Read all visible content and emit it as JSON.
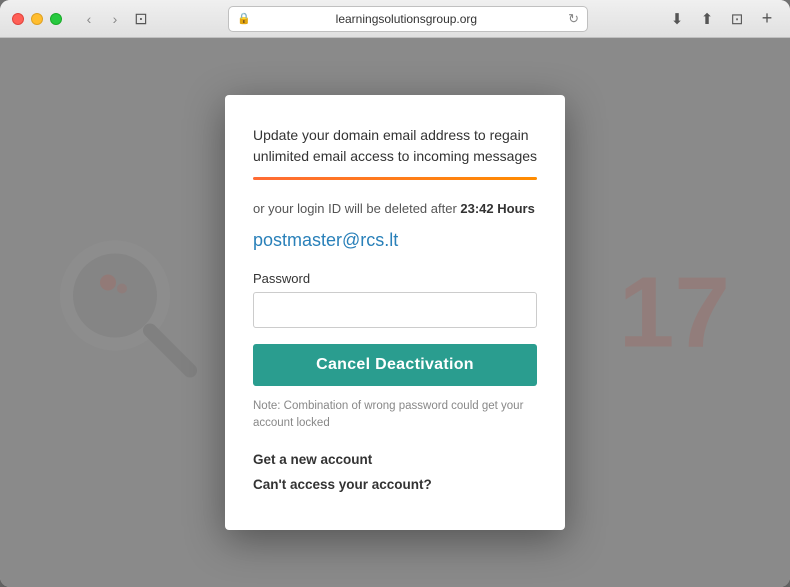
{
  "browser": {
    "url": "learningsolutionsgroup.org",
    "back_disabled": false,
    "forward_disabled": false
  },
  "modal": {
    "header_line1": "Update your domain email address to regain",
    "header_line2": "unlimited email access to incoming messages",
    "warning_prefix": "or your login ID will be deleted after ",
    "timer": "23:42 Hours",
    "email": "postmaster@rcs.lt",
    "password_label": "Password",
    "password_placeholder": "",
    "cancel_button_label": "Cancel Deactivation",
    "note_text": "Note: Combination of wrong password could get your account locked",
    "link1": "Get a new account",
    "link2": "Can't access your account?"
  },
  "icons": {
    "lock": "🔒",
    "refresh": "↻",
    "download": "⬇",
    "share": "↑",
    "tabs": "⊡",
    "plus": "+",
    "back": "‹",
    "forward": "›",
    "sidebar": "☰"
  }
}
